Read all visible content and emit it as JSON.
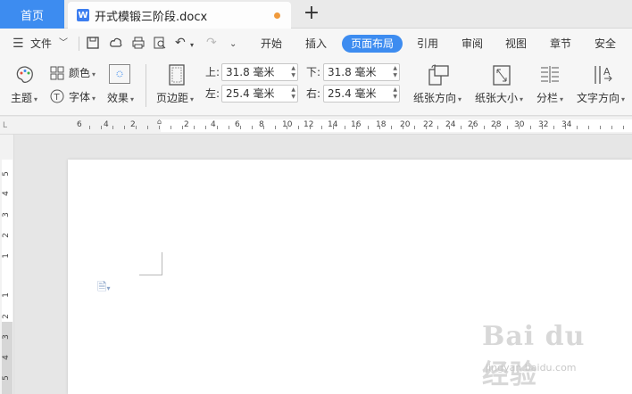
{
  "tabs": {
    "home": "首页",
    "document": "开式模锻三阶段.docx",
    "new": "+"
  },
  "menu": {
    "file": "文件",
    "items": [
      "开始",
      "插入",
      "页面布局",
      "引用",
      "审阅",
      "视图",
      "章节",
      "安全"
    ],
    "active": "页面布局"
  },
  "ribbon": {
    "theme": "主题",
    "color": "颜色",
    "font": "字体",
    "effect": "效果",
    "margins": "页边距",
    "top_label": "上:",
    "top_value": "31.8 毫米",
    "bottom_label": "下:",
    "bottom_value": "31.8 毫米",
    "left_label": "左:",
    "left_value": "25.4 毫米",
    "right_label": "右:",
    "right_value": "25.4 毫米",
    "orientation": "纸张方向",
    "size": "纸张大小",
    "columns": "分栏",
    "text_direction": "文字方向"
  },
  "ruler_h": [
    "6",
    "4",
    "2",
    "2",
    "4",
    "6",
    "8",
    "10",
    "12",
    "14",
    "16",
    "18",
    "20",
    "22",
    "24",
    "26",
    "28",
    "30",
    "32",
    "34"
  ],
  "ruler_v": [
    "5",
    "4",
    "3",
    "2",
    "1",
    "1",
    "2",
    "3",
    "4",
    "5"
  ],
  "watermark": {
    "logo": "Bai du 经验",
    "url": "jingyan.baidu.com"
  },
  "colors": {
    "accent": "#3d8cf0",
    "doc_dot": "#f09a3c"
  }
}
